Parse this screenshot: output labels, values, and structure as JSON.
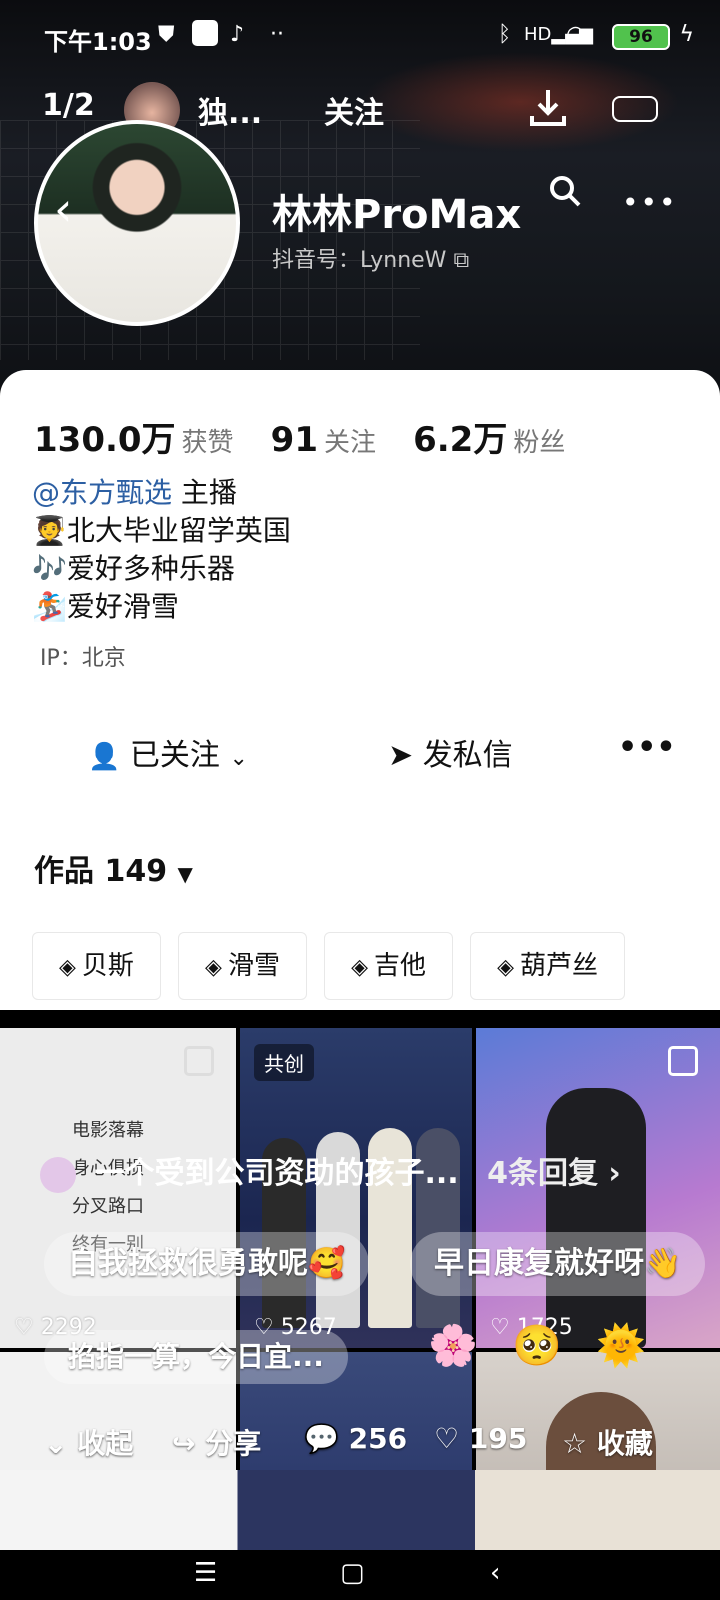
{
  "status_bar": {
    "time": "下午1:03",
    "battery": "96"
  },
  "overlay_bar": {
    "counter": "1/2",
    "title": "独...",
    "follow": "关注"
  },
  "profile": {
    "nickname": "林林ProMax",
    "account_label": "抖音号：LynneW"
  },
  "stats": [
    {
      "num": "130.0万",
      "label": "获赞"
    },
    {
      "num": "91",
      "label": "关注"
    },
    {
      "num": "6.2万",
      "label": "粉丝"
    }
  ],
  "bio": {
    "mention": "@东方甄选",
    "role": " 主播",
    "lines": [
      "🧑‍🎓北大毕业留学英国",
      "🎶爱好多种乐器",
      "🏂爱好滑雪"
    ]
  },
  "ip": "IP：北京",
  "actions": {
    "followed": "已关注",
    "message": "发私信",
    "more": "•••"
  },
  "works": {
    "label": "作品 149"
  },
  "collections": [
    "贝斯",
    "滑雪",
    "吉他",
    "葫芦丝"
  ],
  "grid": {
    "cell1_list": [
      "电影落幕",
      "身心俱损",
      "分叉路口",
      "终有一别"
    ],
    "cell1_likes": "2292",
    "cell2_tag": "共创",
    "cell2_likes": "5267",
    "cell3_likes": "1725"
  },
  "comments": {
    "top_comment": "一个受到公司资助的孩子...",
    "replies": "4条回复 ›",
    "bubble_left": "自我拯救很勇敢呢🥰",
    "bubble_right": "早日康复就好呀👋",
    "danmu": "掐指一算，今日宜..."
  },
  "bottom_actions": {
    "collapse": "收起",
    "share": "分享",
    "comments": "256",
    "likes": "195",
    "favorite": "收藏"
  },
  "colors": {
    "mention": "#2c5fa3",
    "battery": "#51c24d"
  }
}
